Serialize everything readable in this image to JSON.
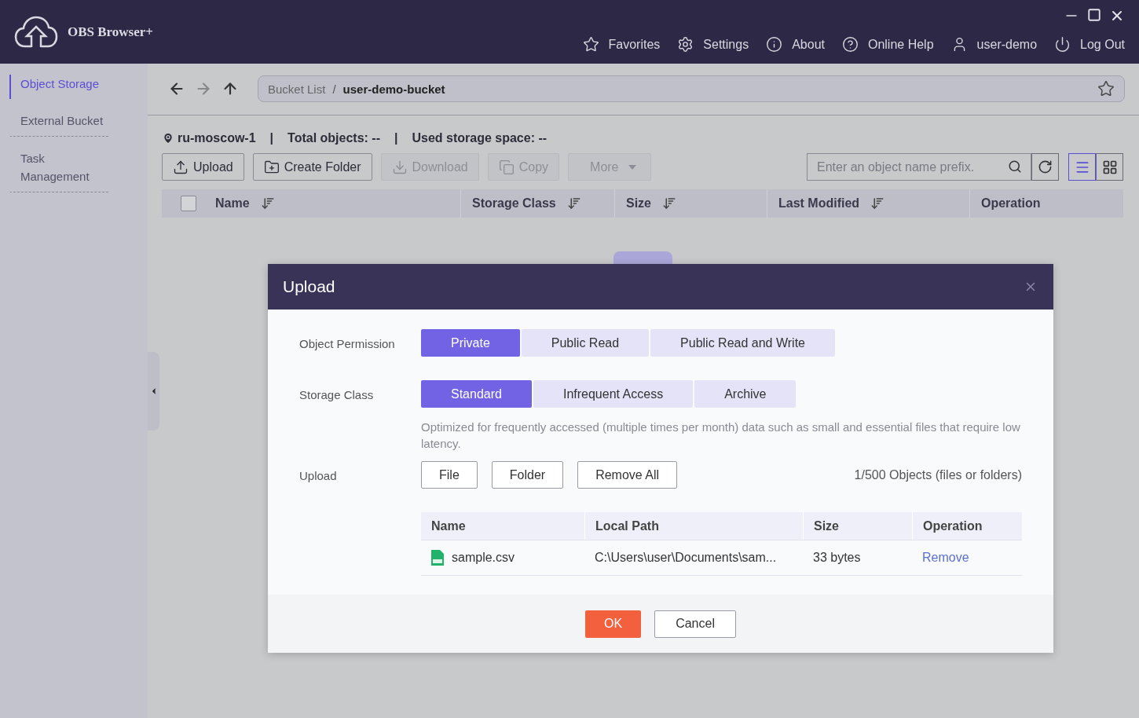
{
  "header": {
    "app_title": "OBS Browser+",
    "nav": [
      {
        "kind": "star",
        "label": "Favorites"
      },
      {
        "kind": "gear",
        "label": "Settings"
      },
      {
        "kind": "info",
        "label": "About"
      },
      {
        "kind": "help",
        "label": "Online Help"
      },
      {
        "kind": "user",
        "label": "user-demo"
      },
      {
        "kind": "power",
        "label": "Log Out"
      }
    ]
  },
  "sidebar": {
    "items": [
      {
        "label": "Object Storage",
        "selected": true
      },
      {
        "label": "External Bucket",
        "selected": false
      },
      {
        "label": "Task Management",
        "selected": false
      }
    ]
  },
  "breadcrumb": [
    {
      "kind": "crumb",
      "label": "Bucket List",
      "current": false
    },
    {
      "kind": "separator",
      "label": "/",
      "current": false
    },
    {
      "kind": "crumb",
      "label": "user-demo-bucket",
      "current": true
    }
  ],
  "info_bar": [
    {
      "kind": "region",
      "text": "ru-moscow-1"
    },
    {
      "kind": "separator",
      "text": "|"
    },
    {
      "kind": "plain",
      "text": "Total objects: --"
    },
    {
      "kind": "separator",
      "text": "|"
    },
    {
      "kind": "plain",
      "text": "Used storage space: --"
    }
  ],
  "toolbar": [
    {
      "kind": "upload",
      "label": "Upload",
      "disabled": false
    },
    {
      "kind": "folder",
      "label": "Create Folder",
      "disabled": false
    },
    {
      "kind": "download",
      "label": "Download",
      "disabled": true
    },
    {
      "kind": "copy",
      "label": "Copy",
      "disabled": true
    },
    {
      "kind": "more",
      "label": "More",
      "disabled": true
    }
  ],
  "search": {
    "placeholder": "Enter an object name prefix."
  },
  "views": [
    {
      "kind": "list",
      "selected": true
    },
    {
      "kind": "grid",
      "selected": false
    }
  ],
  "table": {
    "select_all": false,
    "columns": [
      {
        "label": "Name",
        "sortable": true
      },
      {
        "label": "Storage Class",
        "sortable": true
      },
      {
        "label": "Size",
        "sortable": true
      },
      {
        "label": "Last Modified",
        "sortable": true
      },
      {
        "label": "Operation",
        "sortable": false
      }
    ]
  },
  "dialog": {
    "title": "Upload",
    "permission": {
      "label": "Object Permission",
      "options": [
        {
          "label": "Private",
          "selected": true
        },
        {
          "label": "Public Read",
          "selected": false
        },
        {
          "label": "Public Read and Write",
          "selected": false
        }
      ]
    },
    "storage_class": {
      "label": "Storage Class",
      "options": [
        {
          "label": "Standard",
          "selected": true
        },
        {
          "label": "Infrequent Access",
          "selected": false
        },
        {
          "label": "Archive",
          "selected": false
        }
      ],
      "description": "Optimized for frequently accessed (multiple times per month) data such as small and essential files that require low latency."
    },
    "upload": {
      "label": "Upload",
      "buttons": [
        "File",
        "Folder",
        "Remove All"
      ],
      "count": "1/500 Objects (files or folders)"
    },
    "files": {
      "columns": [
        "Name",
        "Local Path",
        "Size",
        "Operation"
      ],
      "rows": [
        {
          "name": "sample.csv",
          "local_path": "C:\\Users\\user\\Documents\\sam...",
          "size": "33 bytes",
          "operation": "Remove"
        }
      ]
    },
    "footer": [
      {
        "kind": "primary",
        "label": "OK"
      },
      {
        "kind": "secondary",
        "label": "Cancel"
      }
    ]
  }
}
